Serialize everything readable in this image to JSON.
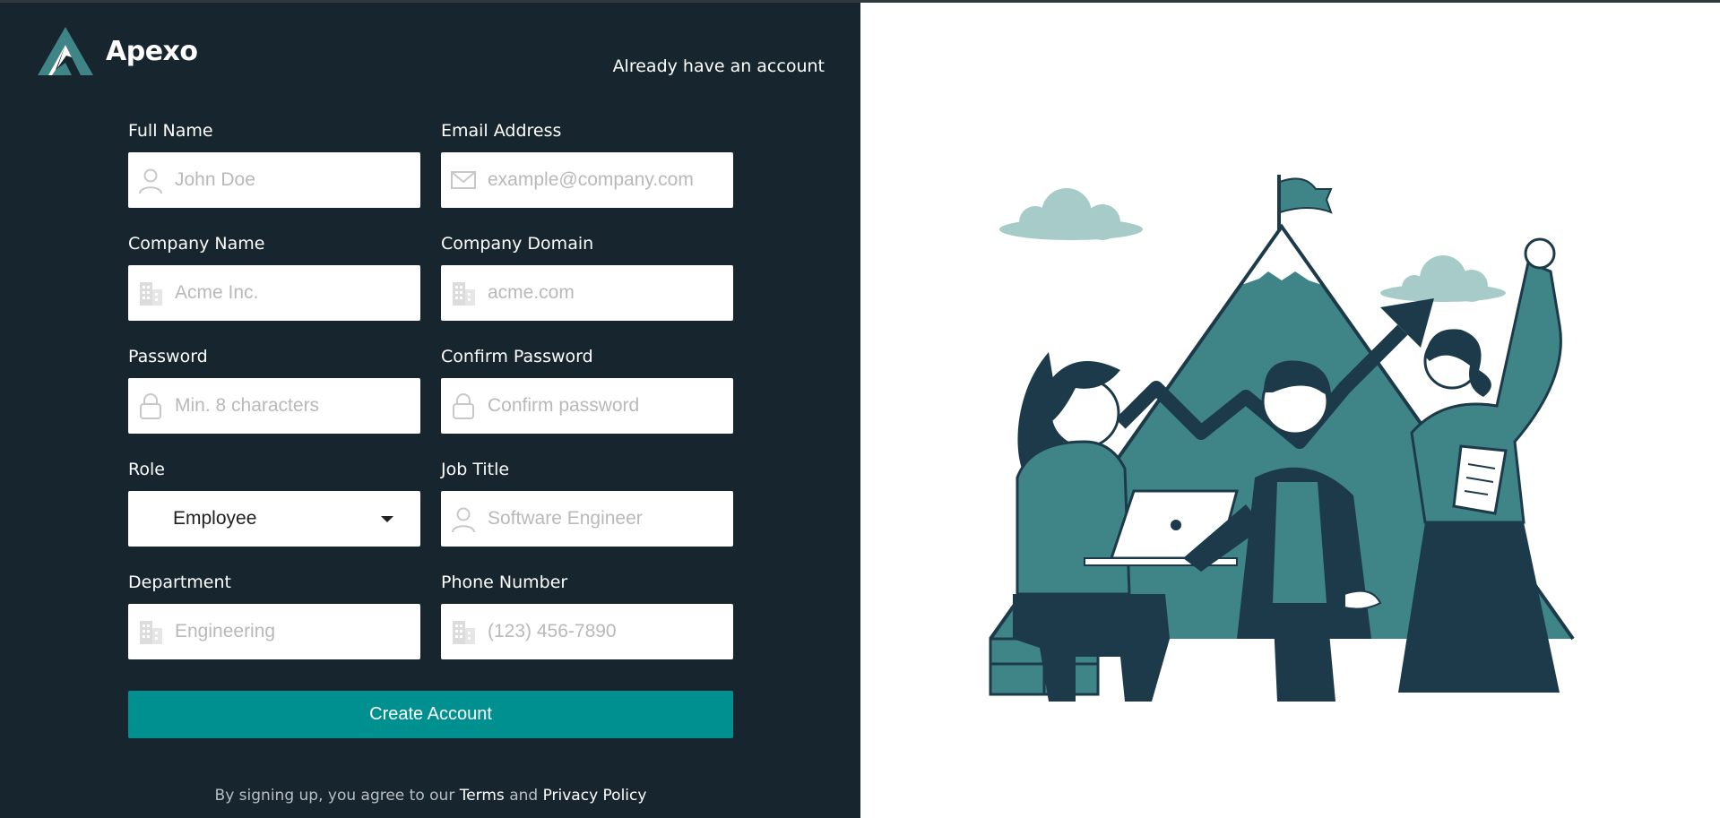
{
  "brand": {
    "name": "Apexo"
  },
  "header": {
    "login_link": "Already have an account"
  },
  "form": {
    "full_name": {
      "label": "Full Name",
      "placeholder": "John Doe",
      "icon": "user-icon"
    },
    "email": {
      "label": "Email Address",
      "placeholder": "example@company.com",
      "icon": "envelope-icon"
    },
    "company_name": {
      "label": "Company Name",
      "placeholder": "Acme Inc.",
      "icon": "building-icon"
    },
    "company_domain": {
      "label": "Company Domain",
      "placeholder": "acme.com",
      "icon": "building-icon"
    },
    "password": {
      "label": "Password",
      "placeholder": "Min. 8 characters",
      "icon": "lock-icon"
    },
    "confirm_password": {
      "label": "Confirm Password",
      "placeholder": "Confirm password",
      "icon": "lock-icon"
    },
    "role": {
      "label": "Role",
      "value": "Employee"
    },
    "job_title": {
      "label": "Job Title",
      "placeholder": "Software Engineer",
      "icon": "user-icon"
    },
    "department": {
      "label": "Department",
      "placeholder": "Engineering",
      "icon": "building-icon"
    },
    "phone": {
      "label": "Phone Number",
      "placeholder": "(123) 456-7890",
      "icon": "building-icon"
    },
    "submit_label": "Create Account"
  },
  "footer": {
    "prefix": "By signing up, you agree to our",
    "terms": "Terms",
    "and": "and",
    "privacy": "Privacy Policy"
  },
  "colors": {
    "panel_bg": "#17252e",
    "accent": "#009090",
    "illustration_teal": "#3f8587",
    "illustration_dark": "#1d3a4a"
  }
}
